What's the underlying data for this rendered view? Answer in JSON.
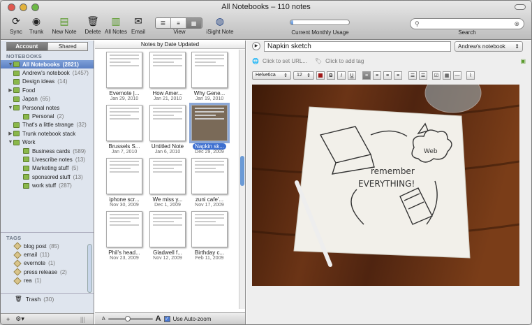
{
  "window": {
    "title": "All Notebooks – 110 notes"
  },
  "toolbar": {
    "sync": "Sync",
    "trunk": "Trunk",
    "new_note": "New Note",
    "delete": "Delete",
    "all_notes": "All Notes",
    "email": "Email",
    "view": "View",
    "isight": "iSight Note",
    "usage": "Current Monthly Usage",
    "usage_fraction": 0.05,
    "search": "Search"
  },
  "sidebar": {
    "tabs": [
      "Account",
      "Shared"
    ],
    "notebooks_header": "NOTEBOOKS",
    "notebooks": [
      {
        "label": "All Notebooks",
        "count": "(2821)",
        "level": 0,
        "tri": "▼",
        "selected": true
      },
      {
        "label": "Andrew's notebook",
        "count": "(1457)",
        "level": 0,
        "tri": ""
      },
      {
        "label": "Design ideas",
        "count": "(14)",
        "level": 0,
        "tri": ""
      },
      {
        "label": "Food",
        "count": "",
        "level": 0,
        "tri": "▶"
      },
      {
        "label": "Japan",
        "count": "(65)",
        "level": 0,
        "tri": ""
      },
      {
        "label": "Personal notes",
        "count": "",
        "level": 0,
        "tri": "▼"
      },
      {
        "label": "Personal",
        "count": "(2)",
        "level": 1,
        "tri": ""
      },
      {
        "label": "That's a little strange",
        "count": "(32)",
        "level": 0,
        "tri": ""
      },
      {
        "label": "Trunk notebook stack",
        "count": "",
        "level": 0,
        "tri": "▶"
      },
      {
        "label": "Work",
        "count": "",
        "level": 0,
        "tri": "▼"
      },
      {
        "label": "Business cards",
        "count": "(589)",
        "level": 1,
        "tri": ""
      },
      {
        "label": "Livescribe notes",
        "count": "(13)",
        "level": 1,
        "tri": ""
      },
      {
        "label": "Marketing stuff",
        "count": "(5)",
        "level": 1,
        "tri": ""
      },
      {
        "label": "sponsored stuff",
        "count": "(13)",
        "level": 1,
        "tri": ""
      },
      {
        "label": "work stuff",
        "count": "(287)",
        "level": 1,
        "tri": ""
      }
    ],
    "tags_header": "TAGS",
    "tags": [
      {
        "label": "blog post",
        "count": "(85)"
      },
      {
        "label": "email",
        "count": "(11)"
      },
      {
        "label": "evernote",
        "count": "(1)"
      },
      {
        "label": "press release",
        "count": "(2)"
      },
      {
        "label": "rea",
        "count": "(1)"
      }
    ],
    "trash": {
      "label": "Trash",
      "count": "(30)"
    }
  },
  "notes_list": {
    "header": "Notes by Date Updated",
    "notes": [
      {
        "title": "Evernote |...",
        "date": "Jan 29, 2010"
      },
      {
        "title": "How Amer...",
        "date": "Jan 21, 2010"
      },
      {
        "title": "Why Gene...",
        "date": "Jan 19, 2010"
      },
      {
        "title": "Brussels S...",
        "date": "Jan 7, 2010"
      },
      {
        "title": "Untitled Note",
        "date": "Jan 6, 2010"
      },
      {
        "title": "Napkin sk...",
        "date": "Dec 29, 2009",
        "selected": true
      },
      {
        "title": "iphone scr...",
        "date": "Nov 30, 2009"
      },
      {
        "title": "We miss y...",
        "date": "Dec 1, 2009"
      },
      {
        "title": "zuni cafe'...",
        "date": "Nov 17, 2009"
      },
      {
        "title": "Phil's head...",
        "date": "Nov 23, 2009"
      },
      {
        "title": "Gladwell f...",
        "date": "Nov 12, 2009"
      },
      {
        "title": "Birthday c...",
        "date": "Feb 11, 2009"
      }
    ],
    "zoom_small": "A",
    "zoom_large": "A",
    "auto_zoom": "Use Auto-zoom"
  },
  "editor": {
    "title": "Napkin sketch",
    "notebook": "Andrew's notebook",
    "url_placeholder": "Click to set URL...",
    "tag_placeholder": "Click to add tag",
    "font": "Helvetica",
    "size": "12",
    "napkin_text": [
      "remember",
      "EVERYTHING!"
    ],
    "cloud_text": "Web"
  },
  "colors": {
    "selection": "#5a7fc2",
    "notebook_icon": "#8ab84a",
    "wood": "#5a2b12"
  }
}
